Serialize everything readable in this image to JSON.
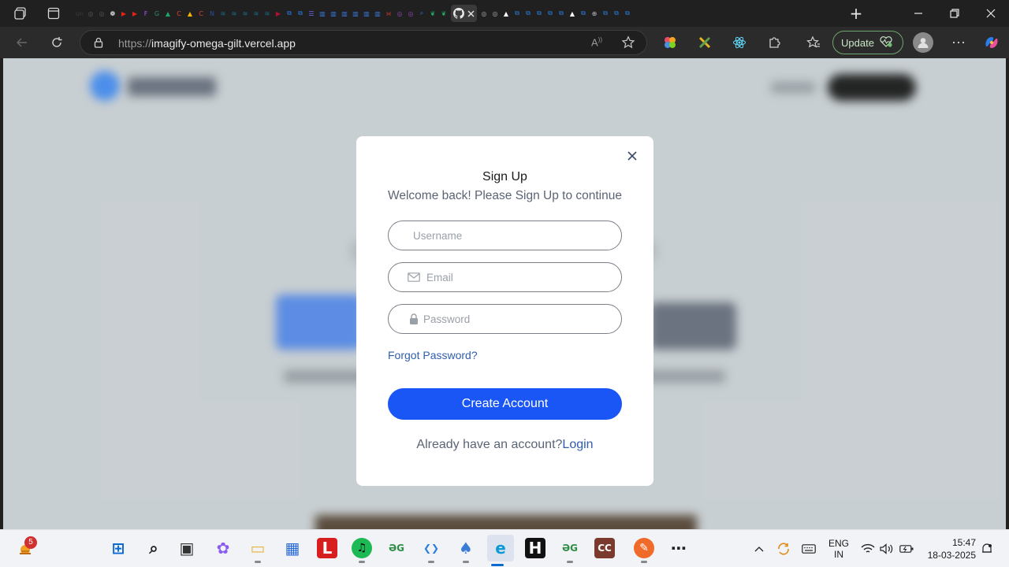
{
  "browser": {
    "url_protocol": "https://",
    "url_host": "imagify-omega-gilt.vercel.app",
    "update_label": "Update",
    "tab_favicons": [
      {
        "name": "unsplash",
        "text": "un",
        "color": "#3b3b3b"
      },
      {
        "name": "chatgpt",
        "text": "◎",
        "color": "#555555"
      },
      {
        "name": "chatgpt",
        "text": "◎",
        "color": "#555555"
      },
      {
        "name": "openai",
        "text": "❁",
        "color": "#ffffff"
      },
      {
        "name": "youtube",
        "text": "▶",
        "color": "#e62117"
      },
      {
        "name": "youtube",
        "text": "▶",
        "color": "#e62117"
      },
      {
        "name": "figma",
        "text": "F",
        "color": "#a259ff"
      },
      {
        "name": "genai",
        "text": "G",
        "color": "#2a8f6a"
      },
      {
        "name": "drive",
        "text": "▲",
        "color": "#1fa463"
      },
      {
        "name": "chrome",
        "text": "C",
        "color": "#db4437"
      },
      {
        "name": "drive",
        "text": "▲",
        "color": "#f4b400"
      },
      {
        "name": "chrome",
        "text": "C",
        "color": "#db4437"
      },
      {
        "name": "netflix",
        "text": "N",
        "color": "#2b4d9a"
      },
      {
        "name": "web",
        "text": "≋",
        "color": "#1b6e8a"
      },
      {
        "name": "web",
        "text": "≋",
        "color": "#1b6e8a"
      },
      {
        "name": "web",
        "text": "≋",
        "color": "#1b6e8a"
      },
      {
        "name": "web",
        "text": "≋",
        "color": "#1b6e8a"
      },
      {
        "name": "web",
        "text": "≋",
        "color": "#1b6e8a"
      },
      {
        "name": "youtube",
        "text": "▶",
        "color": "#b3112e"
      }
    ],
    "tab_favicons_right": [
      {
        "name": "app",
        "text": "⧉",
        "color": "#2a7de1"
      },
      {
        "name": "app",
        "text": "⧉",
        "color": "#2a7de1"
      },
      {
        "name": "list",
        "text": "☰",
        "color": "#6a6af0"
      },
      {
        "name": "chart",
        "text": "▥",
        "color": "#3a7be0"
      },
      {
        "name": "chart",
        "text": "▥",
        "color": "#3a7be0"
      },
      {
        "name": "chart",
        "text": "▥",
        "color": "#3a7be0"
      },
      {
        "name": "chart",
        "text": "▥",
        "color": "#3a7be0"
      },
      {
        "name": "chart",
        "text": "▥",
        "color": "#3a7be0"
      },
      {
        "name": "chart",
        "text": "▥",
        "color": "#3a7be0"
      },
      {
        "name": "app",
        "text": "ᴍ",
        "color": "#c0392b"
      },
      {
        "name": "app",
        "text": "◎",
        "color": "#8e44ad"
      },
      {
        "name": "app",
        "text": "◎",
        "color": "#8e44ad"
      },
      {
        "name": "search",
        "text": "⌕",
        "color": "#2a7de1"
      },
      {
        "name": "leaf",
        "text": "❦",
        "color": "#27ae60"
      },
      {
        "name": "leaf",
        "text": "❦",
        "color": "#27ae60"
      }
    ],
    "tab_favicons_far": [
      {
        "name": "chatgpt",
        "text": "◎",
        "color": "#aaaaaa"
      },
      {
        "name": "chatgpt",
        "text": "◎",
        "color": "#aaaaaa"
      },
      {
        "name": "vercel",
        "text": "▲",
        "color": "#ffffff"
      },
      {
        "name": "app",
        "text": "⧉",
        "color": "#2a7de1"
      },
      {
        "name": "app",
        "text": "⧉",
        "color": "#2a7de1"
      },
      {
        "name": "app",
        "text": "⧉",
        "color": "#2a7de1"
      },
      {
        "name": "app",
        "text": "⧉",
        "color": "#2a7de1"
      },
      {
        "name": "app",
        "text": "⧉",
        "color": "#2a7de1"
      },
      {
        "name": "vercel",
        "text": "▲",
        "color": "#ffffff"
      },
      {
        "name": "app",
        "text": "⧉",
        "color": "#2a7de1"
      },
      {
        "name": "web",
        "text": "⊕",
        "color": "#bbbbbb"
      },
      {
        "name": "app",
        "text": "⧉",
        "color": "#2a7de1"
      },
      {
        "name": "app",
        "text": "⧉",
        "color": "#2a7de1"
      },
      {
        "name": "app",
        "text": "⧉",
        "color": "#2a7de1"
      }
    ]
  },
  "modal": {
    "title": "Sign Up",
    "subtitle": "Welcome back! Please Sign Up to continue",
    "username_placeholder": "Username",
    "email_placeholder": "Email",
    "password_placeholder": "Password",
    "forgot_label": "Forgot Password?",
    "create_label": "Create Account",
    "already_text": "Already have an account?",
    "login_label": "Login"
  },
  "taskbar": {
    "weather_badge": "5",
    "apps": [
      {
        "name": "start",
        "text": "⊞",
        "color": "#0a6ad1"
      },
      {
        "name": "search",
        "text": "⌕",
        "color": "#222222"
      },
      {
        "name": "task-view",
        "text": "▣",
        "color": "#333333"
      },
      {
        "name": "copilot",
        "text": "✿",
        "color": "#8a5cf0"
      },
      {
        "name": "file-explorer",
        "text": "▭",
        "color": "#e8b43a"
      },
      {
        "name": "store",
        "text": "▦",
        "color": "#2a6ad8"
      },
      {
        "name": "l-app",
        "text": "L",
        "color": "#d81f1f"
      },
      {
        "name": "spotify",
        "text": "♫",
        "color": "#1db954"
      },
      {
        "name": "gfg",
        "text": "ƏG",
        "color": "#2f8d46"
      },
      {
        "name": "vscode",
        "text": "❮❯",
        "color": "#2a7de1"
      },
      {
        "name": "solitaire",
        "text": "♠",
        "color": "#3a7bd5"
      },
      {
        "name": "edge",
        "text": "e",
        "color": "#0c9ad6"
      },
      {
        "name": "hackerrank",
        "text": "H",
        "color": "#111111"
      },
      {
        "name": "gfg-2",
        "text": "ƏG",
        "color": "#2f8d46"
      },
      {
        "name": "cc",
        "text": "CC",
        "color": "#7a3b2e"
      },
      {
        "name": "pen",
        "text": "✎",
        "color": "#f06a2a"
      },
      {
        "name": "more",
        "text": "⋯",
        "color": "#222222"
      }
    ],
    "lang_line1": "ENG",
    "lang_line2": "IN",
    "time": "15:47",
    "date": "18-03-2025"
  }
}
